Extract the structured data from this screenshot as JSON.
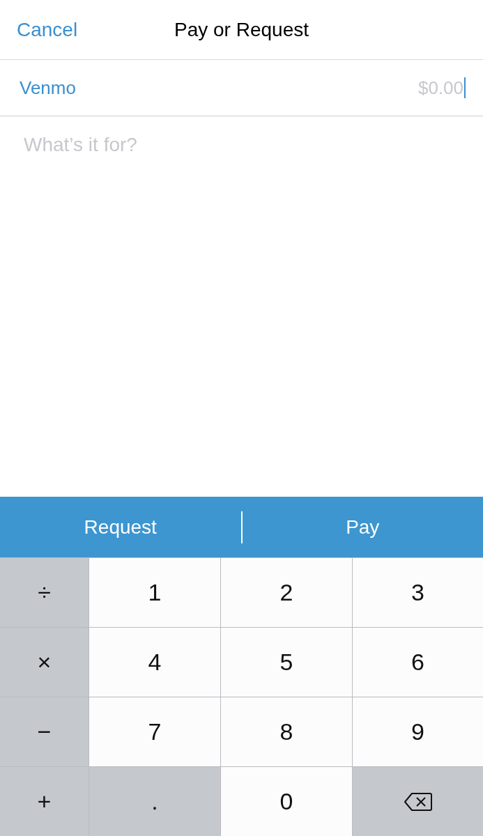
{
  "header": {
    "cancel": "Cancel",
    "title": "Pay or Request"
  },
  "recipient": {
    "name": "Venmo",
    "amount": {
      "placeholder": "$0.00"
    }
  },
  "note": {
    "placeholder": "What’s it for?"
  },
  "actions": [
    {
      "label": "Request"
    },
    {
      "label": "Pay"
    }
  ],
  "keypad": [
    [
      {
        "kind": "operator",
        "label": "÷"
      },
      {
        "kind": "digit",
        "label": "1"
      },
      {
        "kind": "digit",
        "label": "2"
      },
      {
        "kind": "digit",
        "label": "3"
      }
    ],
    [
      {
        "kind": "operator",
        "label": "×"
      },
      {
        "kind": "digit",
        "label": "4"
      },
      {
        "kind": "digit",
        "label": "5"
      },
      {
        "kind": "digit",
        "label": "6"
      }
    ],
    [
      {
        "kind": "operator",
        "label": "−"
      },
      {
        "kind": "digit",
        "label": "7"
      },
      {
        "kind": "digit",
        "label": "8"
      },
      {
        "kind": "digit",
        "label": "9"
      }
    ],
    [
      {
        "kind": "operator",
        "label": "+"
      },
      {
        "kind": "operator",
        "label": "."
      },
      {
        "kind": "digit",
        "label": "0"
      },
      {
        "kind": "backspace"
      }
    ]
  ]
}
